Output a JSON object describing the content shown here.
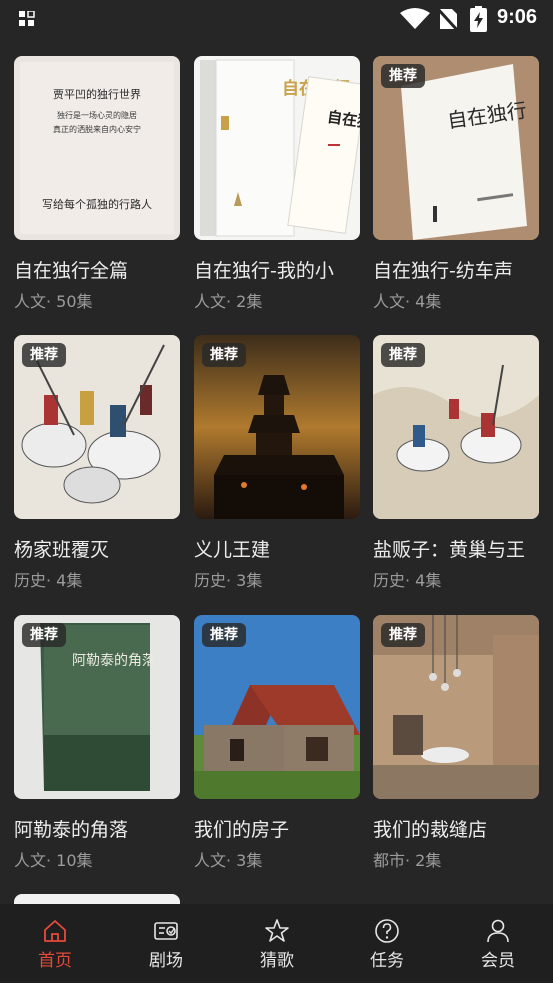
{
  "status_bar": {
    "time": "9:06"
  },
  "cards": [
    {
      "title": "自在独行全篇",
      "meta": "人文· 50集",
      "badge": ""
    },
    {
      "title": "自在独行-我的小",
      "meta": "人文· 2集",
      "badge": ""
    },
    {
      "title": "自在独行-纺车声",
      "meta": "人文· 4集",
      "badge": "推荐"
    },
    {
      "title": "杨家班覆灭",
      "meta": "历史· 4集",
      "badge": "推荐"
    },
    {
      "title": "义儿王建",
      "meta": "历史· 3集",
      "badge": "推荐"
    },
    {
      "title": "盐贩子：黄巢与王",
      "meta": "历史· 4集",
      "badge": "推荐"
    },
    {
      "title": "阿勒泰的角落",
      "meta": "人文· 10集",
      "badge": "推荐"
    },
    {
      "title": "我们的房子",
      "meta": "人文· 3集",
      "badge": "推荐"
    },
    {
      "title": "我们的裁缝店",
      "meta": "都市· 2集",
      "badge": "推荐"
    }
  ],
  "cover_text": {
    "c1_line1": "贾平凹的独行世界",
    "c1_line2": "独行是一场心灵的隐居",
    "c1_line3": "真正的洒脱来自内心安宁",
    "c1_line4": "写给每个孤独的行路人",
    "c2_title": "自在独行",
    "c2_calligraphy": "自在独行",
    "c3_title": "自在独行",
    "c7_title": "阿勒泰的角落"
  },
  "nav": [
    {
      "label": "首页",
      "icon": "home-icon",
      "active": true
    },
    {
      "label": "剧场",
      "icon": "theater-icon",
      "active": false
    },
    {
      "label": "猜歌",
      "icon": "star-icon",
      "active": false
    },
    {
      "label": "任务",
      "icon": "help-icon",
      "active": false
    },
    {
      "label": "会员",
      "icon": "user-icon",
      "active": false
    }
  ],
  "colors": {
    "background": "#262626",
    "accent": "#e64a3b",
    "navbar": "#1f1f1f"
  }
}
